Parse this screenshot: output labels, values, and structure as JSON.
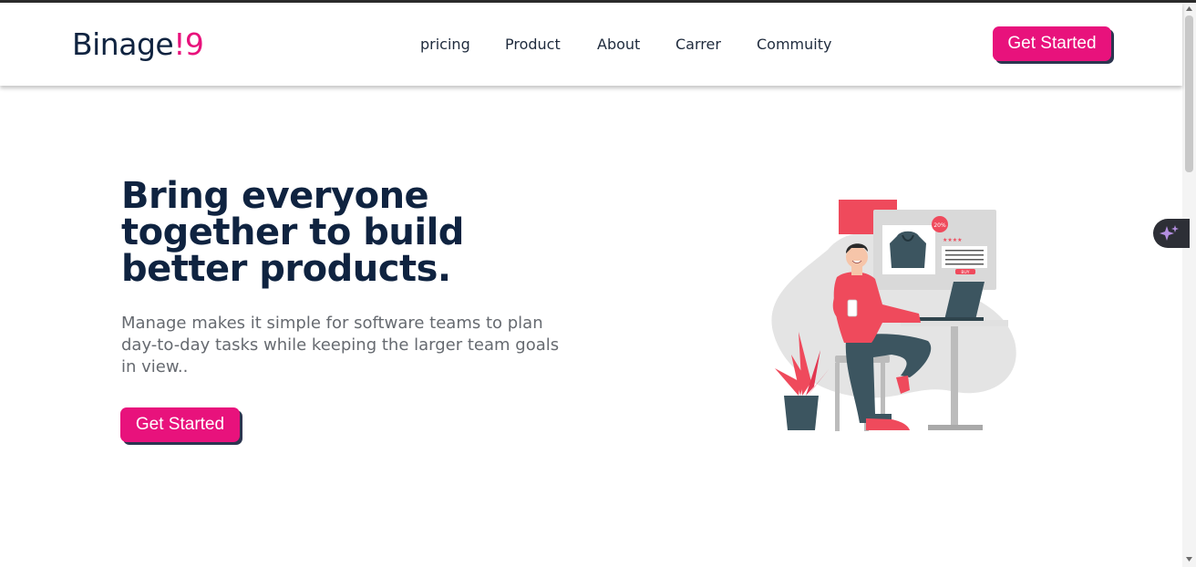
{
  "brand": {
    "name_main": "Binage",
    "name_accent": "!9",
    "accent_color": "#e8127c",
    "dark_color": "#0f2340"
  },
  "nav": {
    "links": [
      "pricing",
      "Product",
      "About",
      "Carrer",
      "Commuity"
    ],
    "cta_label": "Get Started"
  },
  "hero": {
    "title": "Bring everyone together to build better products.",
    "subtitle": "Manage makes it simple for software teams to plan day-to-day tasks while keeping the larger team goals in view..",
    "cta_label": "Get Started"
  },
  "illustration": {
    "badge_text": "20%",
    "buy_text": "BUY",
    "icon": "shopping-illustration"
  },
  "widgets": {
    "ai_button_icon": "sparkle-icon"
  }
}
